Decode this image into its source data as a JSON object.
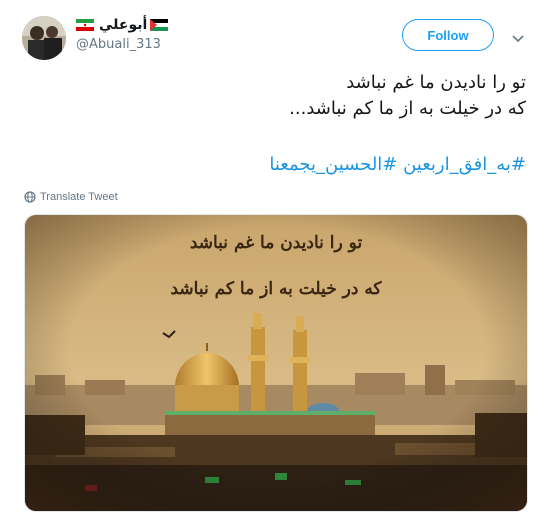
{
  "tweet": {
    "author": {
      "display_name": "أبوعلي",
      "handle": "@Abuali_313",
      "flags": [
        "iran-flag",
        "palestine-flag"
      ]
    },
    "follow_label": "Follow",
    "text_lines": [
      "تو را نادیدن ما غم نباشد",
      "که در خیلت به از ما کم نباشد..."
    ],
    "hashtags": "#به_افق_اربعین #الحسین_یجمعنا",
    "translate_label": "Translate Tweet",
    "image": {
      "caption_lines": [
        "تو را نادیدن ما غم نباشد",
        "که در خیلت به از ما کم نباشد"
      ]
    }
  },
  "icons": {
    "caret": "chevron-down-icon",
    "globe": "globe-icon"
  },
  "colors": {
    "accent": "#1da1f2",
    "hashtag": "#1b95e0",
    "secondary_text": "#657786"
  }
}
